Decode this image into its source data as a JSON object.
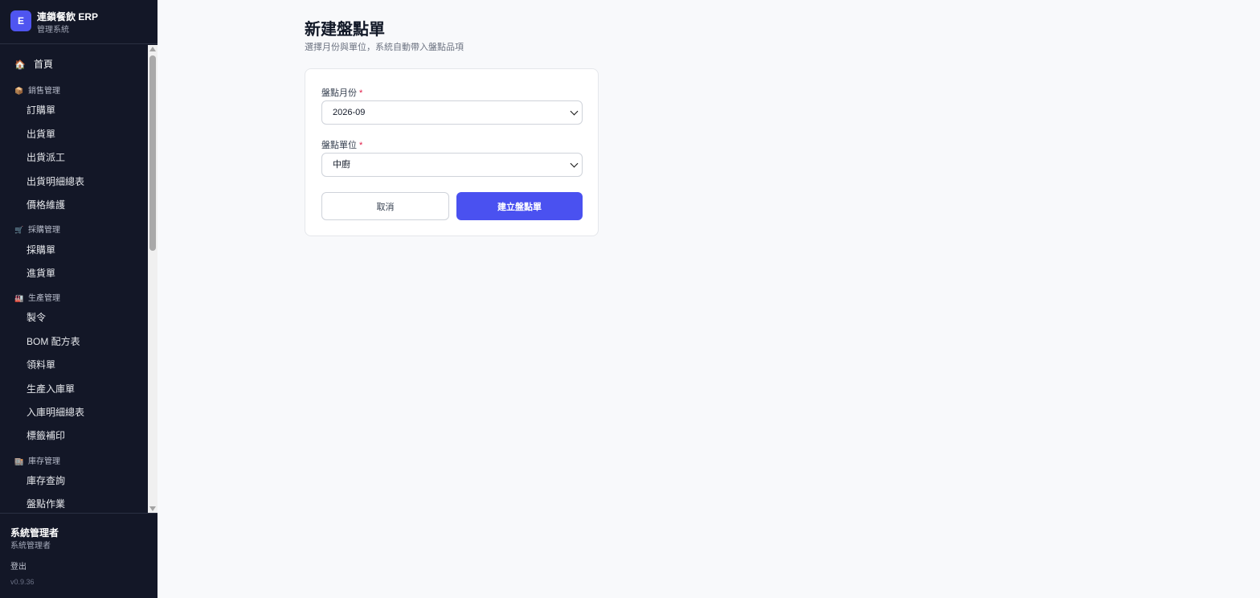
{
  "brand": {
    "logo_letter": "E",
    "title": "連鎖餐飲 ERP",
    "subtitle": "管理系統"
  },
  "nav": {
    "home": {
      "icon": "house-icon",
      "label": "首頁"
    },
    "groups": [
      {
        "icon": "box-icon",
        "label": "銷售管理",
        "items": [
          "訂購單",
          "出貨單",
          "出貨派工",
          "出貨明細總表",
          "價格維護"
        ]
      },
      {
        "icon": "cart-icon",
        "label": "採購管理",
        "items": [
          "採購單",
          "進貨單"
        ]
      },
      {
        "icon": "factory-icon",
        "label": "生產管理",
        "items": [
          "製令",
          "BOM 配方表",
          "領料單",
          "生產入庫單",
          "入庫明細總表",
          "標籤補印"
        ]
      },
      {
        "icon": "warehouse-icon",
        "label": "庫存管理",
        "items": [
          "庫存查詢",
          "盤點作業"
        ]
      }
    ]
  },
  "footer": {
    "user_name": "系統管理者",
    "user_role": "系統管理者",
    "logout": "登出",
    "version": "v0.9.36"
  },
  "main": {
    "title": "新建盤點單",
    "subtitle": "選擇月份與單位，系統自動帶入盤點品項",
    "form": {
      "month_label": "盤點月份",
      "month_value": "2026-09",
      "unit_label": "盤點單位",
      "unit_value": "中廚",
      "required_mark": "*",
      "cancel_label": "取消",
      "submit_label": "建立盤點單"
    }
  },
  "colors": {
    "sidebar_bg": "#131727",
    "accent": "#4a51f0",
    "required": "#e11d48"
  }
}
